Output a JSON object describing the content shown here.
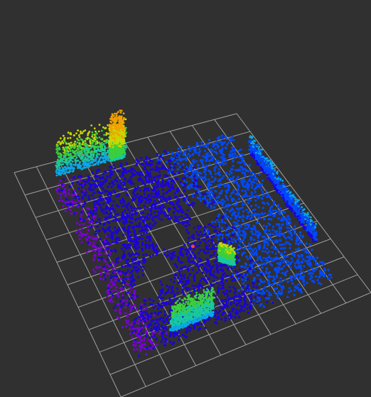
{
  "viewport": {
    "background_color": "#303030",
    "grid_color": "#a0a0a0"
  },
  "point_cloud": {
    "colormap": "rainbow-by-height",
    "color_stops": [
      "#7a00d8",
      "#1a00e0",
      "#0048ff",
      "#0aa8e8",
      "#19c8a0",
      "#3ccf3c",
      "#c8d800",
      "#f0a000",
      "#e02000"
    ]
  },
  "origin_marker": {
    "color": "#ff4040"
  }
}
